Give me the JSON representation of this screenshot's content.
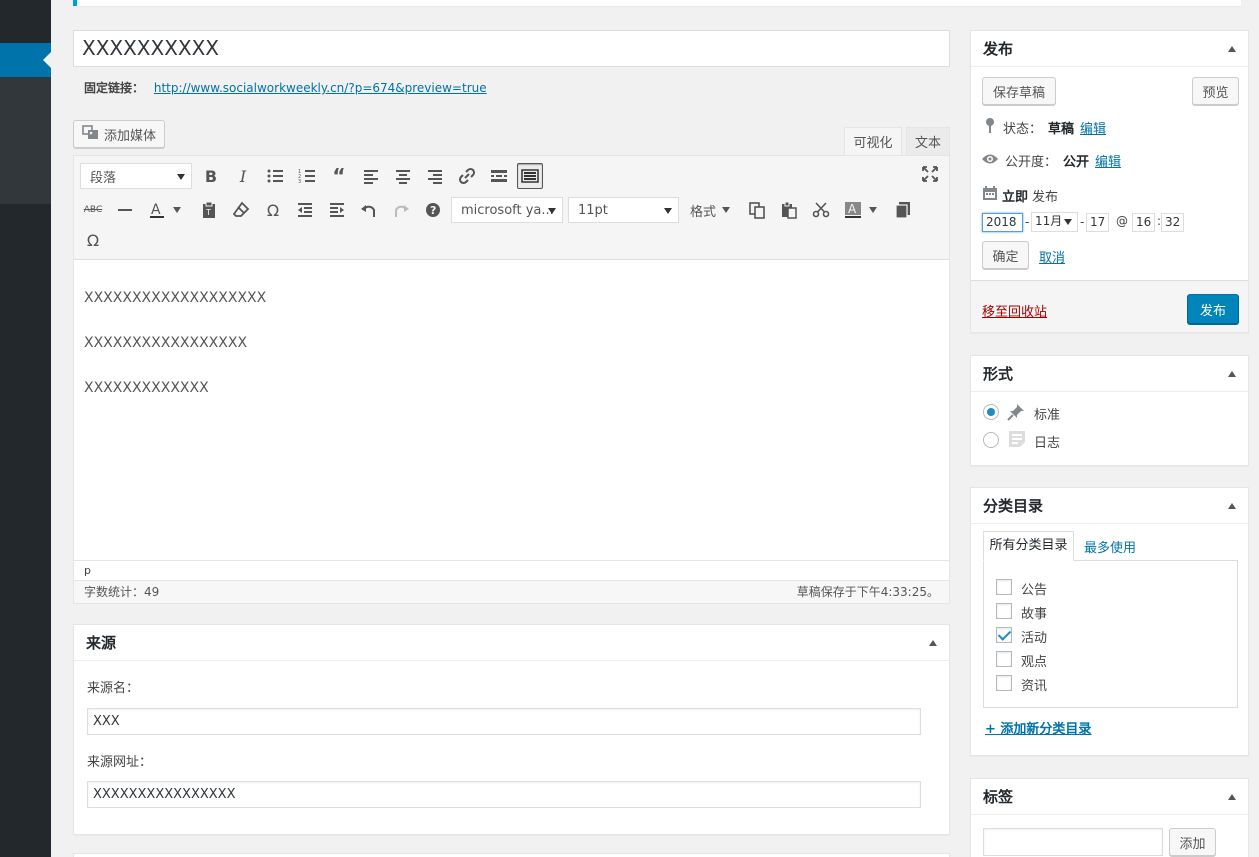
{
  "post": {
    "title": "XXXXXXXXXX",
    "permalink_label": "固定链接：",
    "permalink_url": "http://www.socialworkweekly.cn/?p=674&preview=true"
  },
  "editor": {
    "add_media": "添加媒体",
    "tab_visual": "可视化",
    "tab_text": "文本",
    "format_select": "段落",
    "font_family": "microsoft ya...",
    "font_size": "11pt",
    "formats_menu": "格式",
    "paragraphs": [
      "XXXXXXXXXXXXXXXXXXX",
      "XXXXXXXXXXXXXXXXX",
      "XXXXXXXXXXXXX"
    ],
    "path": "p",
    "word_count": "字数统计：49",
    "autosave": "草稿保存于下午4:33:25。"
  },
  "source_box": {
    "title": "来源",
    "name_label": "来源名：",
    "name_value": "XXX",
    "url_label": "来源网址：",
    "url_value": "XXXXXXXXXXXXXXXX"
  },
  "publish": {
    "title": "发布",
    "save_draft": "保存草稿",
    "preview": "预览",
    "status_label": "状态：",
    "status_value": "草稿",
    "visibility_label": "公开度：",
    "visibility_value": "公开",
    "edit": "编辑",
    "schedule_immediate": "立即",
    "schedule_suffix": "发布",
    "year": "2018",
    "month": "11月",
    "day": "17",
    "hour": "16",
    "minute": "32",
    "date_sep": "-",
    "at_sep": "@",
    "time_sep": ":",
    "ok": "确定",
    "cancel": "取消",
    "trash": "移至回收站",
    "publish_button": "发布"
  },
  "format_box": {
    "title": "形式",
    "options": [
      {
        "label": "标准",
        "checked": true
      },
      {
        "label": "日志",
        "checked": false
      }
    ]
  },
  "category_box": {
    "title": "分类目录",
    "tab_all": "所有分类目录",
    "tab_popular": "最多使用",
    "items": [
      {
        "label": "公告",
        "checked": false
      },
      {
        "label": "故事",
        "checked": false
      },
      {
        "label": "活动",
        "checked": true
      },
      {
        "label": "观点",
        "checked": false
      },
      {
        "label": "资讯",
        "checked": false
      }
    ],
    "add_new": "+ 添加新分类目录"
  },
  "tags_box": {
    "title": "标签",
    "add_button": "添加"
  },
  "colors": {
    "accent": "#0073aa",
    "primary_button": "#0085ba",
    "sidebar": "#23282d"
  }
}
